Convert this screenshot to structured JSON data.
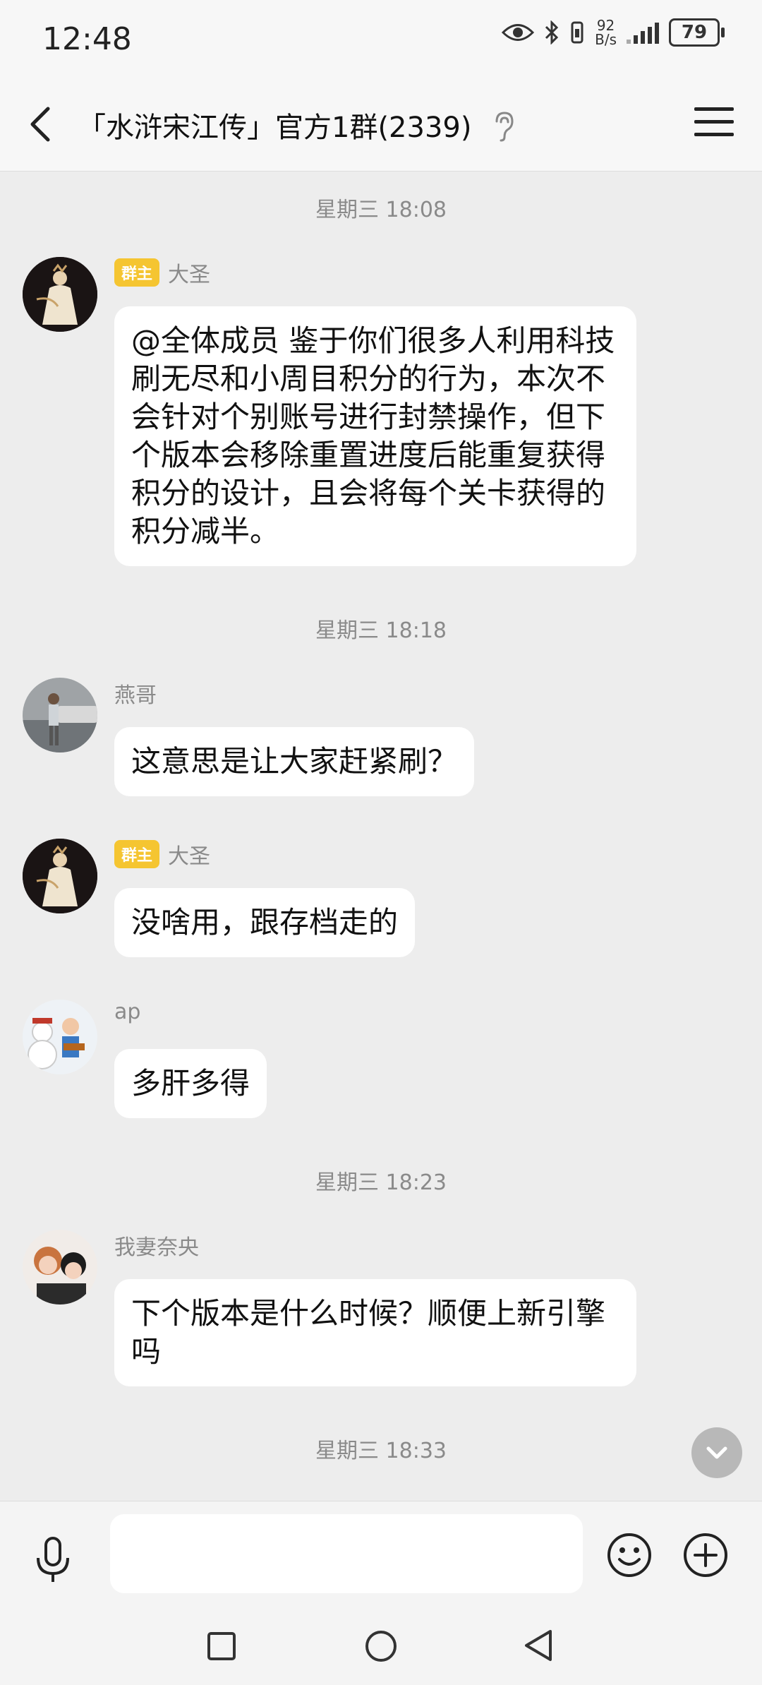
{
  "status_bar": {
    "time": "12:48",
    "net_speed_value": "92",
    "net_speed_unit": "B/s",
    "battery": "79",
    "icons": [
      "eye-icon",
      "bluetooth-icon",
      "vibrate-icon",
      "signal-icon",
      "battery-icon"
    ]
  },
  "header": {
    "title": "「水浒宋江传」官方1群(2339)",
    "icons": [
      "back-arrow-icon",
      "ear-icon",
      "hamburger-menu-icon"
    ]
  },
  "messages": [
    {
      "type": "timestamp",
      "text": "星期三 18:08"
    },
    {
      "type": "message",
      "sender": "大圣",
      "badge": "群主",
      "text": "@全体成员 鉴于你们很多人利用科技刷无尽和小周目积分的行为，本次不会针对个别账号进行封禁操作，但下个版本会移除重置进度后能重复获得积分的设计，且会将每个关卡获得的积分减半。"
    },
    {
      "type": "timestamp",
      "text": "星期三 18:18"
    },
    {
      "type": "message",
      "sender": "燕哥",
      "text": "这意思是让大家赶紧刷？"
    },
    {
      "type": "message",
      "sender": "大圣",
      "badge": "群主",
      "text": "没啥用，跟存档走的"
    },
    {
      "type": "message",
      "sender": "ap",
      "text": "多肝多得"
    },
    {
      "type": "timestamp",
      "text": "星期三 18:23"
    },
    {
      "type": "message",
      "sender": "我妻奈央",
      "text": "下个版本是什么时候？顺便上新引擎吗"
    },
    {
      "type": "timestamp",
      "text": "星期三 18:33"
    }
  ],
  "input_bar": {
    "message_value": "",
    "icons": [
      "microphone-icon",
      "emoji-icon",
      "plus-icon"
    ]
  },
  "nav_bar": {
    "icons": [
      "recent-apps-icon",
      "home-icon",
      "back-icon"
    ]
  },
  "colors": {
    "chat_background": "#ededed",
    "bubble": "#ffffff",
    "badge": "#f5c531"
  }
}
